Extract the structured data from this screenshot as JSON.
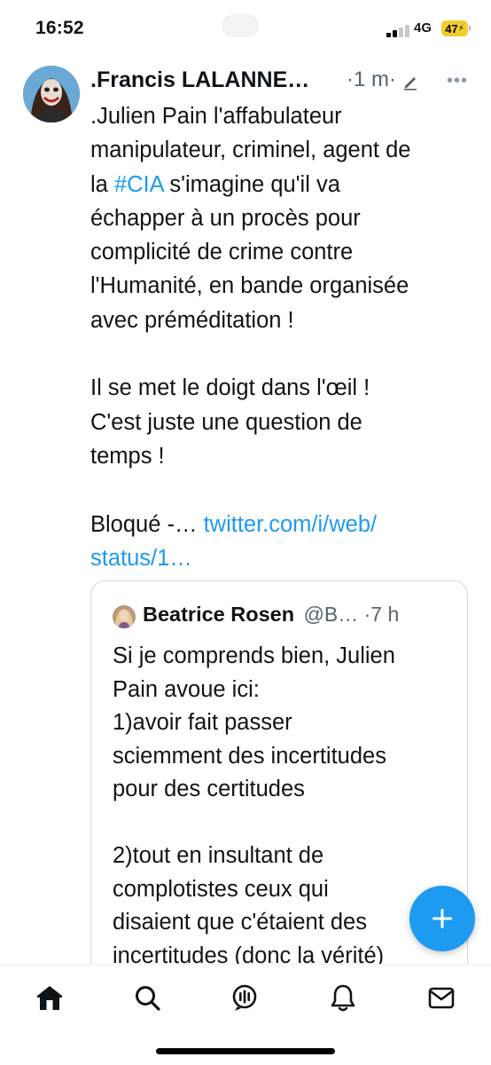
{
  "status_bar": {
    "time": "16:52",
    "network": "4G",
    "battery": "47"
  },
  "tweet": {
    "author_name": ".Francis LALANNE…",
    "time": "·1 m·",
    "lines": [
      ".Julien Pain l'affabulateur",
      "manipulateur, criminel, agent de",
      [
        "la ",
        "#CIA",
        " s'imagine qu'il va"
      ],
      "échapper à un procès pour",
      "complicité de crime contre",
      "l'Humanité, en bande organisée",
      "avec préméditation !",
      "",
      "Il se met le doigt dans l'œil !",
      "C'est juste une question de",
      "temps !",
      "",
      [
        "Bloqué -… ",
        "twitter.com/i/web/",
        ""
      ],
      [
        "",
        "status/1…",
        ""
      ]
    ]
  },
  "quoted_tweet": {
    "author_name": "Beatrice Rosen",
    "handle": "@B… ·7 h",
    "lines": [
      "Si je comprends bien, Julien",
      "Pain avoue ici:",
      "1)avoir fait passer",
      "sciemment des incertitudes",
      "pour des certitudes",
      "",
      "2)tout en insultant de",
      "complotistes ceux qui",
      "disaient que c'étaient des",
      "incertitudes (donc la vérité)"
    ]
  },
  "colors": {
    "accent": "#1d9bf0",
    "secondary_text": "#536471",
    "battery": "#f2cd2e"
  },
  "icons": {
    "nav": [
      "home-icon",
      "search-icon",
      "spaces-icon",
      "notifications-icon",
      "messages-icon"
    ],
    "fab": "compose-plus-icon",
    "edit": "edit-pencil-icon",
    "more": "more-options-icon"
  }
}
